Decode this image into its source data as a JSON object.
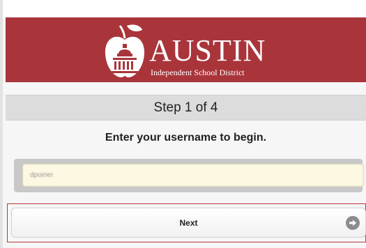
{
  "logo": {
    "word": "AUSTIN",
    "subtitle": "Independent School District"
  },
  "step": {
    "title": "Step 1 of 4"
  },
  "prompt": {
    "text": "Enter your username to begin."
  },
  "username": {
    "value": "dpoirier"
  },
  "next_button": {
    "label": "Next",
    "icon": "arrow-right-circle-icon"
  },
  "colors": {
    "banner": "#a9353b",
    "input_bg": "#fdf8e1",
    "focus_outline": "#b8383f"
  }
}
